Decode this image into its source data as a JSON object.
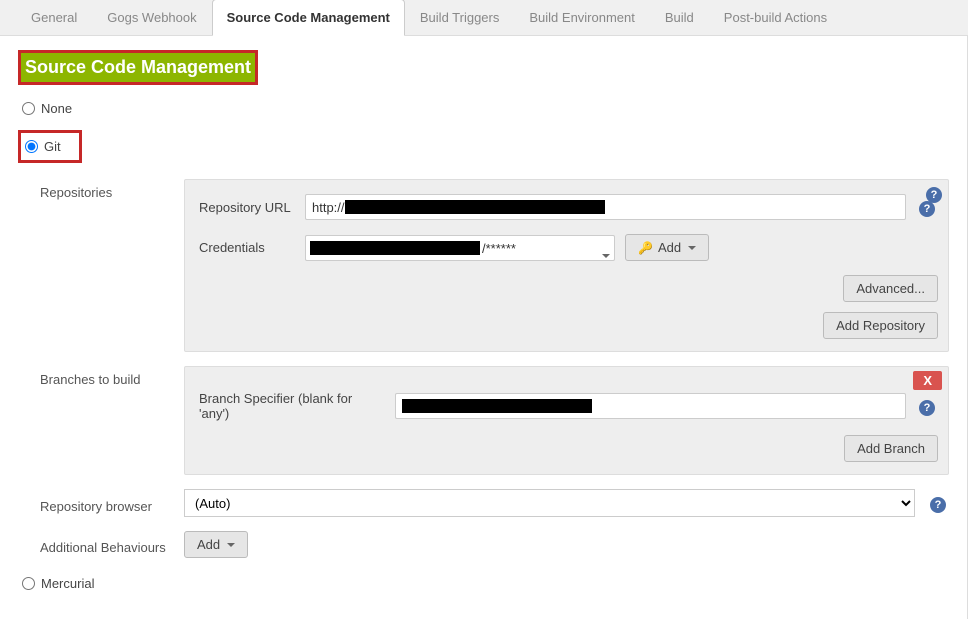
{
  "tabs": [
    {
      "label": "General"
    },
    {
      "label": "Gogs Webhook"
    },
    {
      "label": "Source Code Management"
    },
    {
      "label": "Build Triggers"
    },
    {
      "label": "Build Environment"
    },
    {
      "label": "Build"
    },
    {
      "label": "Post-build Actions"
    }
  ],
  "section_title": "Source Code Management",
  "scm": {
    "none_label": "None",
    "git_label": "Git",
    "mercurial_label": "Mercurial"
  },
  "repositories": {
    "group_label": "Repositories",
    "repo_url_label": "Repository URL",
    "repo_url_prefix": "http://",
    "credentials_label": "Credentials",
    "credentials_visible": "/******",
    "add_button": "Add",
    "advanced_button": "Advanced...",
    "add_repo_button": "Add Repository"
  },
  "branches": {
    "group_label": "Branches to build",
    "specifier_label": "Branch Specifier (blank for 'any')",
    "add_branch_button": "Add Branch",
    "delete_x": "X"
  },
  "repo_browser": {
    "group_label": "Repository browser",
    "selected": "(Auto)"
  },
  "additional": {
    "group_label": "Additional Behaviours",
    "add_button": "Add"
  }
}
